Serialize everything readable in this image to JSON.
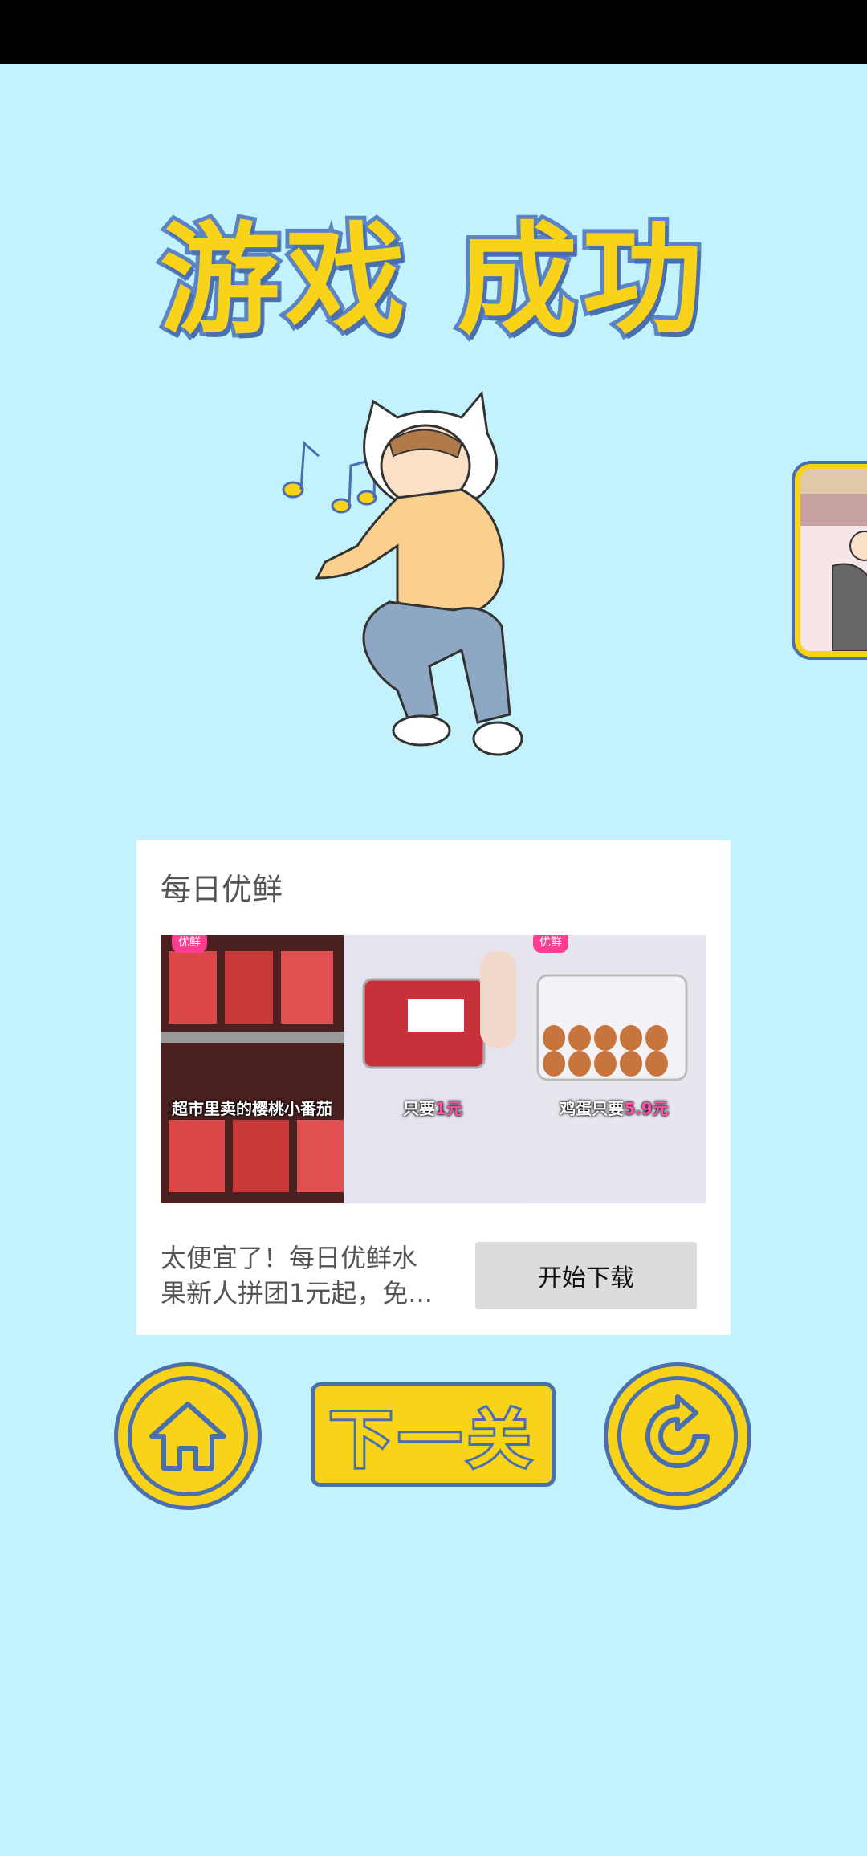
{
  "result": {
    "title": "游戏 成功"
  },
  "ad": {
    "brand": "每日优鲜",
    "panels": [
      {
        "badge": "优鲜",
        "caption": "超市里卖的樱桃小番茄",
        "highlight": ""
      },
      {
        "badge": "",
        "caption": "只要",
        "highlight": "1元"
      },
      {
        "badge": "优鲜",
        "caption": "鸡蛋只要",
        "highlight": "5.9元"
      }
    ],
    "description_line1": "太便宜了！每日优鲜水",
    "description_line2": "果新人拼团1元起，免...",
    "cta": "开始下载"
  },
  "controls": {
    "next_label": "下一关"
  },
  "icons": {
    "notes": "music-notes-icon",
    "home": "home-icon",
    "restart": "restart-icon"
  },
  "colors": {
    "background": "#c3f1fc",
    "accent_yellow": "#f8d31a",
    "outline_blue": "#4a6fae"
  }
}
